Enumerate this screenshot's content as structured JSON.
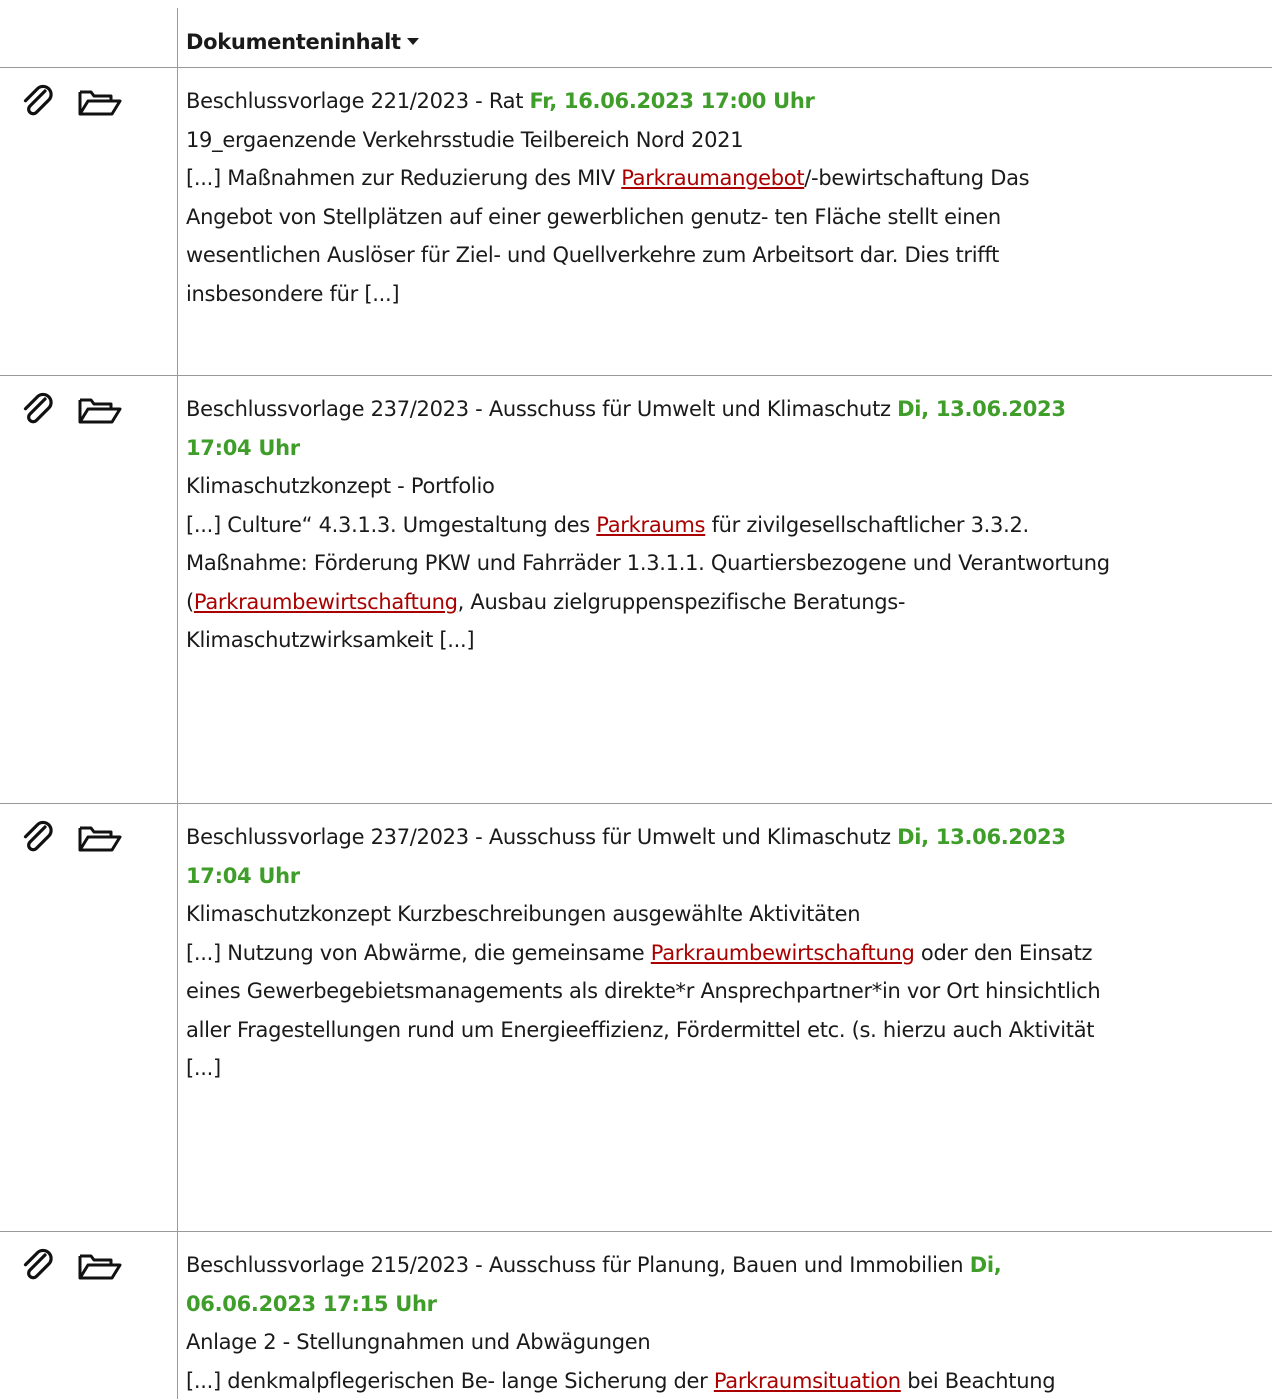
{
  "header": {
    "title": "Dokumenteninhalt"
  },
  "icon_names": {
    "attach": "paperclip-icon",
    "folder": "folder-open-icon"
  },
  "colors": {
    "date": "#3f9e2a",
    "keyword": "#aa0000",
    "grid": "#999999"
  },
  "results": [
    {
      "meta": "Beschlussvorlage 221/2023 - Rat ",
      "date": "Fr, 16.06.2023 17:00 Uhr",
      "doc_title": "19_ergaenzende Verkehrsstudie Teilbereich Nord 2021",
      "snippet_pre": "[...] Maßnahmen zur Reduzierung des MIV ",
      "keyword": "Parkraumangebot",
      "snippet_post": "/-bewirtschaftung Das",
      "snippet_rest": [
        "Angebot von Stellplätzen auf einer gewerblichen genutz- ten Fläche stellt einen",
        "wesentlichen Auslöser für Ziel- und Quellverkehre zum Arbeitsort dar. Dies trifft",
        "insbesondere für [...]"
      ]
    },
    {
      "meta": "Beschlussvorlage 237/2023 - Ausschuss für Umwelt und Klimaschutz ",
      "date_a": "Di, 13.06.2023",
      "date_b": "17:04 Uhr",
      "doc_title": "Klimaschutzkonzept - Portfolio",
      "snippet_pre": "[...] Culture“ 4.3.1.3. Umgestaltung des ",
      "keyword": "Parkraums",
      "snippet_post": " für zivilgesellschaftlicher 3.3.2.",
      "snippet_line2": "Maßnahme: Förderung PKW und Fahrräder 1.3.1.1. Quartiersbezogene und Verantwortung",
      "snippet_line3_pre": "(",
      "keyword2": "Parkraumbewirtschaftung",
      "snippet_line3_post": ", Ausbau zielgruppenspezifische Beratungs-",
      "snippet_line4": "Klimaschutzwirksamkeit [...]"
    },
    {
      "meta": "Beschlussvorlage 237/2023 - Ausschuss für Umwelt und Klimaschutz ",
      "date_a": "Di, 13.06.2023",
      "date_b": "17:04 Uhr",
      "doc_title": "Klimaschutzkonzept Kurzbeschreibungen ausgewählte Aktivitäten",
      "snippet_pre": "[...] Nutzung von Abwärme, die gemeinsame ",
      "keyword": "Parkraumbewirtschaftung",
      "snippet_post": " oder den Einsatz",
      "snippet_rest": [
        "eines Gewerbegebietsmanagements als direkte*r Ansprechpartner*in vor Ort hinsichtlich",
        "aller Fragestellungen rund um Energieeffizienz, Fördermittel etc. (s. hierzu auch Aktivität",
        "[...]"
      ]
    },
    {
      "meta": "Beschlussvorlage 215/2023 - Ausschuss für Planung, Bauen und Immobilien ",
      "date_a": "Di,",
      "date_b": "06.06.2023 17:15 Uhr",
      "doc_title": "Anlage 2 - Stellungnahmen und Abwägungen",
      "snippet_pre": "[...] denkmalpflegerischen Be- lange Sicherung der ",
      "keyword": "Parkraumsituation",
      "snippet_post": " bei Beachtung"
    }
  ]
}
